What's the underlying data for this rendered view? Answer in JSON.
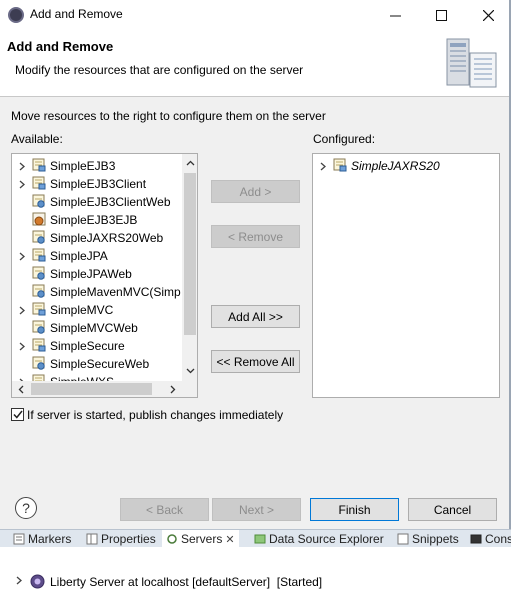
{
  "window": {
    "title": "Add and Remove"
  },
  "header": {
    "title": "Add and Remove",
    "description": "Modify the resources that are configured on the server"
  },
  "instructions": "Move resources to the right to configure them on the server",
  "available": {
    "label": "Available:",
    "items": [
      {
        "label": "SimpleEJB3",
        "expandable": true,
        "icon": "ear-project-icon"
      },
      {
        "label": "SimpleEJB3Client",
        "expandable": true,
        "icon": "ear-project-icon"
      },
      {
        "label": "SimpleEJB3ClientWeb",
        "expandable": false,
        "icon": "web-project-icon"
      },
      {
        "label": "SimpleEJB3EJB",
        "expandable": false,
        "icon": "ejb-project-icon"
      },
      {
        "label": "SimpleJAXRS20Web",
        "expandable": false,
        "icon": "web-project-icon"
      },
      {
        "label": "SimpleJPA",
        "expandable": true,
        "icon": "ear-project-icon"
      },
      {
        "label": "SimpleJPAWeb",
        "expandable": false,
        "icon": "web-project-icon"
      },
      {
        "label": "SimpleMavenMVC(Simp",
        "expandable": false,
        "icon": "web-project-icon"
      },
      {
        "label": "SimpleMVC",
        "expandable": true,
        "icon": "ear-project-icon"
      },
      {
        "label": "SimpleMVCWeb",
        "expandable": false,
        "icon": "web-project-icon"
      },
      {
        "label": "SimpleSecure",
        "expandable": true,
        "icon": "ear-project-icon"
      },
      {
        "label": "SimpleSecureWeb",
        "expandable": false,
        "icon": "web-project-icon"
      },
      {
        "label": "SimpleWXS",
        "expandable": true,
        "icon": "ear-project-icon"
      }
    ]
  },
  "configured": {
    "label": "Configured:",
    "items": [
      {
        "label": "SimpleJAXRS20",
        "expandable": true,
        "icon": "ear-project-icon"
      }
    ]
  },
  "buttons": {
    "add": "Add >",
    "remove": "< Remove",
    "add_all": "Add All >>",
    "remove_all": "<< Remove All",
    "help": "?",
    "back": "< Back",
    "next": "Next >",
    "finish": "Finish",
    "cancel": "Cancel"
  },
  "publish_checkbox": {
    "label": "If server is started, publish changes immediately",
    "checked": true
  },
  "view_tabs": [
    "Markers",
    "Properties",
    "Servers",
    "Data Source Explorer",
    "Snippets",
    "Cons"
  ],
  "server_entry": "Liberty Server at localhost [defaultServer]  [Started]",
  "colors": {
    "accent": "#0078d7",
    "dialog_bg": "#f0f0f0"
  }
}
